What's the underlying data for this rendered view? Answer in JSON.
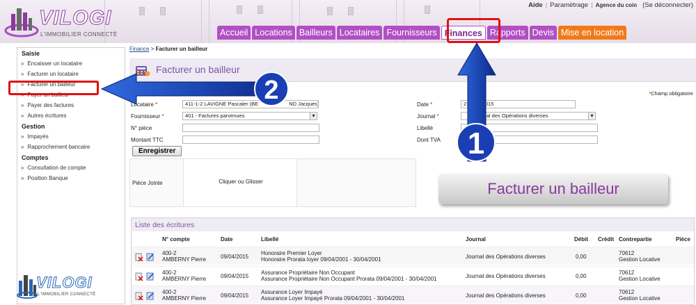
{
  "app": {
    "logo_word": "VILOGI",
    "logo_tagline": "L'IMMOBILIER CONNECTÉ",
    "top_links": {
      "aide": "Aide",
      "parametrage": "Paramétrage",
      "agence": "Agence du coin",
      "deconnect": "(Se déconnecter)"
    }
  },
  "nav": {
    "tabs": [
      {
        "label": "Accueil"
      },
      {
        "label": "Locations"
      },
      {
        "label": "Bailleurs"
      },
      {
        "label": "Locataires"
      },
      {
        "label": "Fournisseurs"
      },
      {
        "label": "Finances"
      },
      {
        "label": "Rapports"
      },
      {
        "label": "Devis"
      },
      {
        "label": "Mise en location"
      }
    ]
  },
  "sidebar": {
    "sections": [
      {
        "title": "Saisie",
        "items": [
          "Encaisser un locataire",
          "Facturer un locataire",
          "Facturer un bailleur",
          "Payer un bailleur",
          "Payer des factures",
          "Autres écritures"
        ]
      },
      {
        "title": "Gestion",
        "items": [
          "Impayés",
          "Rapprochement bancaire"
        ]
      },
      {
        "title": "Comptes",
        "items": [
          "Consultation de compte",
          "Position Banque"
        ]
      }
    ]
  },
  "breadcrumb": {
    "link": "Finance",
    "sep": ">",
    "current": "Facturer un bailleur"
  },
  "page_title": "Facturer un bailleur",
  "required_note": "Champ obligatoire",
  "form": {
    "locataire_label": "Locataire",
    "locataire_value": "411-1-2 LAVIGNE Pascaler (BE",
    "locataire_value_tail": "ND Jacques)",
    "fournisseur_label": "Fournisseur",
    "fournisseur_value": "401 - Factures parvenues",
    "piece_label": "N° pièce",
    "montant_label": "Montant TTC",
    "date_label": "Date",
    "date_value_a": "21/0",
    "date_value_b": "/2015",
    "journal_label": "Journal",
    "journal_value": "Journal des Opérations diverses",
    "libelle_label": "Libellé",
    "tva_label": "Dont TVA",
    "save_label": "Enregistrer",
    "attach_label": "Pièce Jointe",
    "drop_label": "Cliquer ou Glisser"
  },
  "callout": {
    "text": "Facturer un bailleur",
    "step1": "1",
    "step2": "2"
  },
  "ecritures": {
    "title": "Liste des écritures",
    "columns": [
      "N° compte",
      "Date",
      "Libellé",
      "Journal",
      "Débit",
      "Crédit",
      "Contrepartie",
      "Pièce"
    ],
    "rows": [
      {
        "compte": "400-2",
        "nom": "AMBERNY Pierre",
        "date": "09/04/2015",
        "lib1": "Honoraire Premier Loyer",
        "lib2": "Honoraire Prorata loyer 09/04/2001 - 30/04/2001",
        "journal": "Journal des Opérations diverses",
        "debit": "0,00",
        "cp1": "70612",
        "cp2": "Gestion Locative"
      },
      {
        "compte": "400-2",
        "nom": "AMBERNY Pierre",
        "date": "09/04/2015",
        "lib1": "Assurance Propriétaire Non Occupant",
        "lib2": "Assurance Propriétaire Non Occupant Prorata 09/04/2001 - 30/04/2001",
        "journal": "Journal des Opérations diverses",
        "debit": "0,00",
        "cp1": "70612",
        "cp2": "Gestion Locative"
      },
      {
        "compte": "400-2",
        "nom": "AMBERNY Pierre",
        "date": "09/04/2015",
        "lib1": "Assurance Loyer Impayé",
        "lib2": "Assurance Loyer Impayé Prorata 09/04/2001 - 30/04/2001",
        "journal": "Journal des Opérations diverses",
        "debit": "0,00",
        "cp1": "70612",
        "cp2": "Gestion Locative"
      }
    ]
  },
  "colors": {
    "brand_purple": "#b14fc5",
    "accent_orange": "#f07a1a",
    "highlight_red": "#e01010",
    "arrow_blue": "#1a3fb5"
  }
}
